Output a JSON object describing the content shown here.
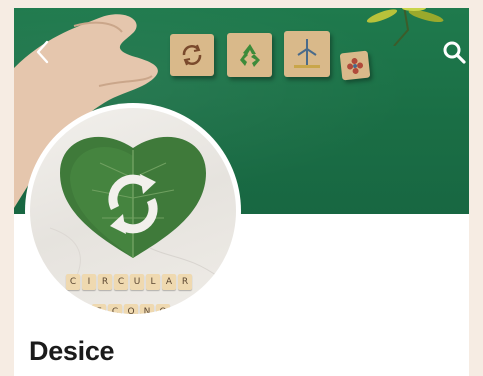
{
  "profile": {
    "name": "Desice"
  },
  "header": {
    "back_icon": "chevron-left-icon",
    "search_icon": "search-icon",
    "blocks": [
      "refresh-arrows-icon",
      "recycle-icon",
      "wind-turbine-icon",
      "flower-icon"
    ]
  },
  "avatar": {
    "tiles_row1": [
      "C",
      "I",
      "R",
      "C",
      "U",
      "L",
      "A",
      "R"
    ],
    "tiles_row2": [
      "E",
      "C",
      "O",
      "N",
      "O"
    ]
  },
  "colors": {
    "header_green": "#1f7a4d",
    "leaf_green": "#3f7a3a",
    "tile": "#efd9b0",
    "name_text": "#1b1b1b"
  }
}
